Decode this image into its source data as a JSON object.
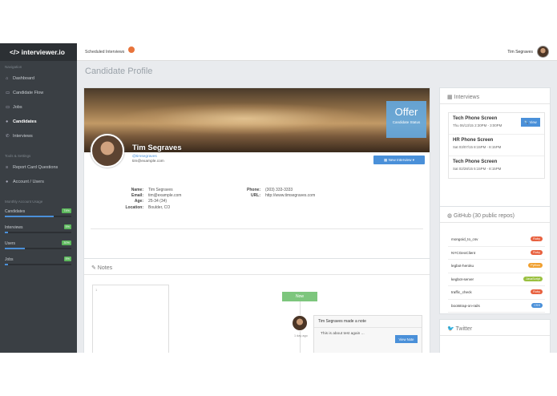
{
  "app": {
    "brand": "</> interviewer.io"
  },
  "sidebar": {
    "nav_heading": "Navigation",
    "items": [
      {
        "label": "Dashboard",
        "icon": "home-icon",
        "glyph": "⌂"
      },
      {
        "label": "Candidate Flow",
        "icon": "flow-icon",
        "glyph": "▭"
      },
      {
        "label": "Jobs",
        "icon": "briefcase-icon",
        "glyph": "▭"
      },
      {
        "label": "Candidates",
        "icon": "user-icon",
        "glyph": "●"
      },
      {
        "label": "Interviews",
        "icon": "phone-icon",
        "glyph": "✆"
      }
    ],
    "tools_heading": "Tools & Settings",
    "tools": [
      {
        "label": "Report Card Questions",
        "icon": "list-icon",
        "glyph": "≡"
      },
      {
        "label": "Account / Users",
        "icon": "user-icon",
        "glyph": "●"
      }
    ],
    "usage_heading": "Monthly Account Usage",
    "usage": [
      {
        "label": "Candidates",
        "badge": "74%",
        "fill": 0.74
      },
      {
        "label": "Interviews",
        "badge": "5%",
        "fill": 0.05
      },
      {
        "label": "Users",
        "badge": "30%",
        "fill": 0.3
      },
      {
        "label": "Jobs",
        "badge": "5%",
        "fill": 0.05
      }
    ]
  },
  "topbar": {
    "scheduled": "Scheduled Interviews",
    "user": "Tim Segraves"
  },
  "page": {
    "title": "Candidate Profile"
  },
  "profile": {
    "status": "Offer",
    "status_label": "Candidate Status",
    "name": "Tim Segraves",
    "handle": "@timsegraves",
    "email": "tim@example.com",
    "new_interview": "▦ New Interview  ▾",
    "details_left": [
      {
        "k": "Name:",
        "v": "Tim Segraves"
      },
      {
        "k": "Email:",
        "v": "tim@example.com"
      },
      {
        "k": "Age:",
        "v": "25-34 (34)"
      },
      {
        "k": "Location:",
        "v": "Boulder, CO"
      }
    ],
    "details_right": [
      {
        "k": "Phone:",
        "v": "(303) 333-3333"
      },
      {
        "k": "URL:",
        "v": "http://www.timsegraves.com"
      }
    ],
    "socials": [
      {
        "name": "delicious-icon",
        "g": "d",
        "c": "#3274d1"
      },
      {
        "name": "grid-icon",
        "g": "▦",
        "c": "#5a8fd0"
      },
      {
        "name": "twitter-icon",
        "g": "t",
        "c": "#4aa3df"
      },
      {
        "name": "tumblr-icon",
        "g": "t",
        "c": "#35465c"
      },
      {
        "name": "power-icon",
        "g": "⏻",
        "c": "#2b78c2"
      },
      {
        "name": "camera-icon",
        "g": "◉",
        "c": "#666666"
      },
      {
        "name": "skype-icon",
        "g": "S",
        "c": "#3a9dd6"
      },
      {
        "name": "cloud-icon",
        "g": "☁",
        "c": "#4b9fd5"
      },
      {
        "name": "stack-icon",
        "g": "✉",
        "c": "#7a8fa6"
      },
      {
        "name": "google-plus-icon",
        "g": "g",
        "c": "#4285f4"
      },
      {
        "name": "scribd-icon",
        "g": "§",
        "c": "#555555"
      },
      {
        "name": "github-icon",
        "g": "◐",
        "c": "#333333"
      },
      {
        "name": "pinterest-icon",
        "g": "P",
        "c": "#cb2027"
      },
      {
        "name": "vimeo-icon",
        "g": "v",
        "c": "#1ab7ea"
      },
      {
        "name": "flickr-icon",
        "g": "••",
        "c": "#ffffff"
      },
      {
        "name": "xing-icon",
        "g": "✕",
        "c": "#e25050"
      },
      {
        "name": "facebook-icon",
        "g": "f",
        "c": "#3b5998"
      },
      {
        "name": "linkedin-icon",
        "g": "in",
        "c": "#0077b5"
      },
      {
        "name": "lastfm-icon",
        "g": "as",
        "c": "#d51007"
      },
      {
        "name": "youtube-icon",
        "g": "▶",
        "c": "#cc3333"
      }
    ]
  },
  "notes": {
    "title": "✎ Notes",
    "line_number": "1",
    "now": "Now",
    "entry_header": "Tim Segraves made a note",
    "entry_body": "This is about test again ...",
    "ago": "1 day ago",
    "view_note": "View Note"
  },
  "interviews": {
    "title": "▦ Interviews",
    "items": [
      {
        "title": "Tech Phone Screen",
        "date": "Thu 06/13/15 2:30PM - 3:00PM",
        "view": "🔍 View"
      },
      {
        "title": "HR Phone Screen",
        "date": "Sat 03/07/15 8:15PM - 8:15PM"
      },
      {
        "title": "Tech Phone Screen",
        "date": "Sat 02/28/15 5:15PM - 8:15PM"
      }
    ]
  },
  "github": {
    "title": "◍ GitHub (30 public repos)",
    "repos": [
      {
        "name": "mongoid_to_csv",
        "lang": "Ruby",
        "color": "#e8613f"
      },
      {
        "name": "NYCGeoClient",
        "lang": "Ruby",
        "color": "#e8613f"
      },
      {
        "name": "legbot-heroku",
        "lang": "Python",
        "color": "#f0a030"
      },
      {
        "name": "kegbot-server",
        "lang": "JavaScript",
        "color": "#9ac040"
      },
      {
        "name": "traffic_check",
        "lang": "Ruby",
        "color": "#e8613f"
      },
      {
        "name": "bootstrap-on-rails",
        "lang": "CSS",
        "color": "#4a90d9"
      }
    ]
  },
  "twitter": {
    "title": "🐦 Twitter"
  }
}
